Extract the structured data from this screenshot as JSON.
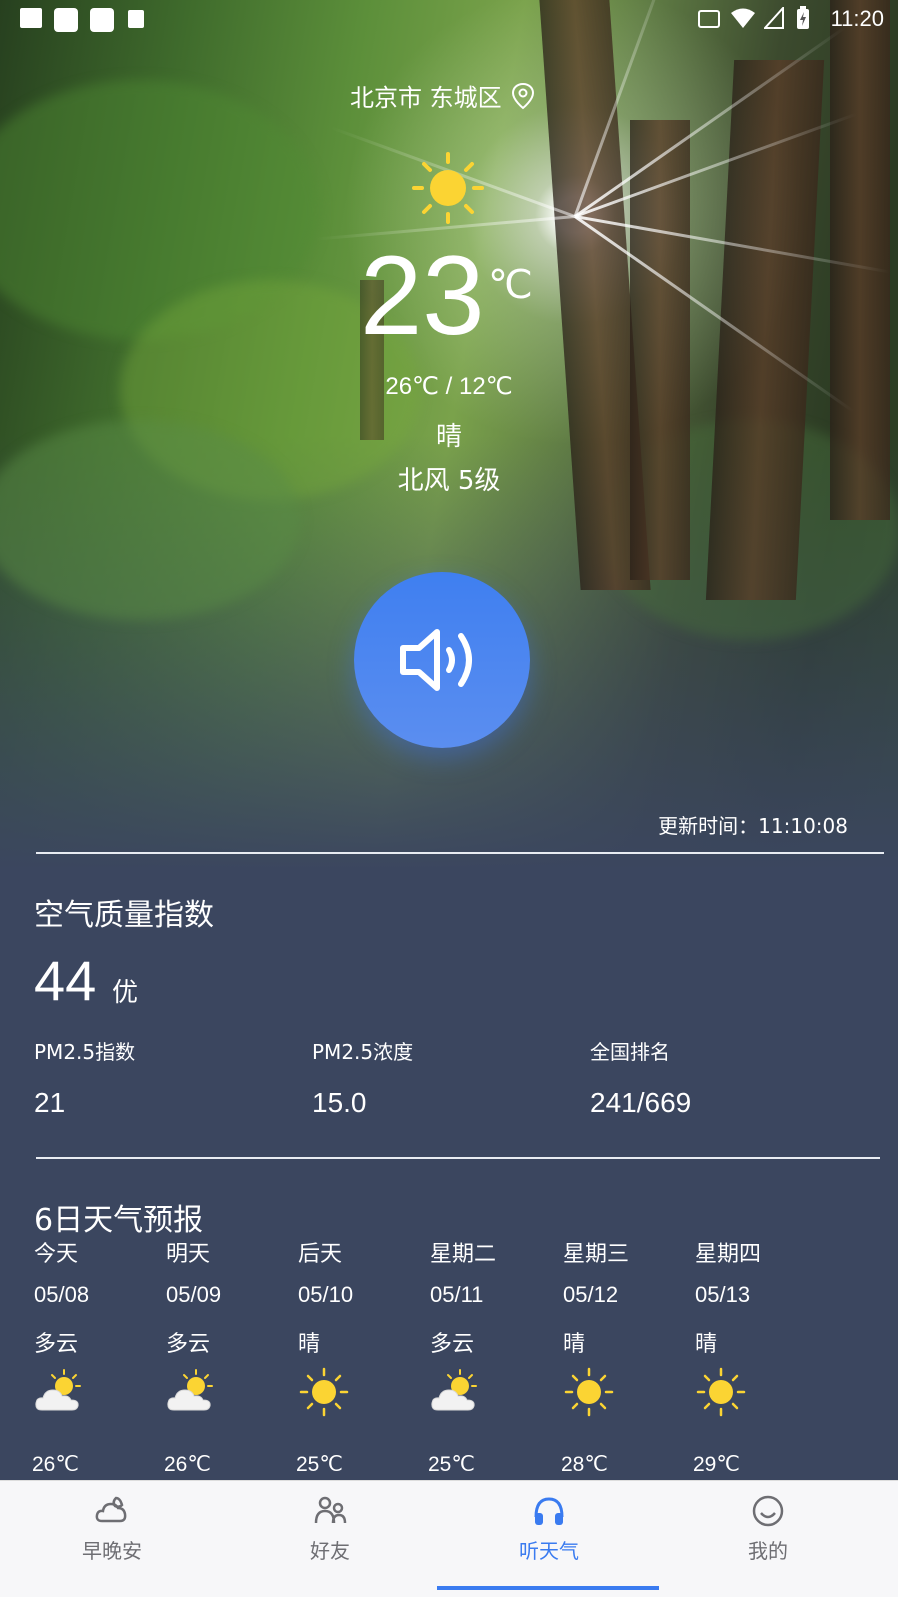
{
  "status_bar": {
    "time": "11:20"
  },
  "location": {
    "text": "北京市 东城区"
  },
  "current": {
    "temp": "23",
    "unit": "℃",
    "range": "26℃  /  12℃",
    "condition": "晴",
    "wind": "北风  5级",
    "update_label": "更新时间：",
    "update_time": "11:10:08"
  },
  "aqi": {
    "title": "空气质量指数",
    "value": "44",
    "level": "优",
    "metrics": [
      {
        "label": "PM2.5指数",
        "value": "21"
      },
      {
        "label": "PM2.5浓度",
        "value": "15.0"
      },
      {
        "label": "全国排名",
        "value": "241/669"
      }
    ]
  },
  "forecast": {
    "title": "6日天气预报",
    "days": [
      {
        "name": "今天",
        "date": "05/08",
        "cond": "多云",
        "icon": "partly-cloudy-icon",
        "hi": "26℃"
      },
      {
        "name": "明天",
        "date": "05/09",
        "cond": "多云",
        "icon": "partly-cloudy-icon",
        "hi": "26℃"
      },
      {
        "name": "后天",
        "date": "05/10",
        "cond": "晴",
        "icon": "sun-icon",
        "hi": "25℃"
      },
      {
        "name": "星期二",
        "date": "05/11",
        "cond": "多云",
        "icon": "partly-cloudy-icon",
        "hi": "25℃"
      },
      {
        "name": "星期三",
        "date": "05/12",
        "cond": "晴",
        "icon": "sun-icon",
        "hi": "28℃"
      },
      {
        "name": "星期四",
        "date": "05/13",
        "cond": "晴",
        "icon": "sun-icon",
        "hi": "29℃"
      }
    ]
  },
  "tabs": [
    {
      "label": "早晚安",
      "icon": "cloud-moon-icon",
      "active": false
    },
    {
      "label": "好友",
      "icon": "friends-icon",
      "active": false
    },
    {
      "label": "听天气",
      "icon": "headphones-icon",
      "active": true
    },
    {
      "label": "我的",
      "icon": "smile-icon",
      "active": false
    }
  ],
  "colors": {
    "accent": "#3a7bf0",
    "panel": "#3b465f",
    "sun": "#fbd433"
  }
}
